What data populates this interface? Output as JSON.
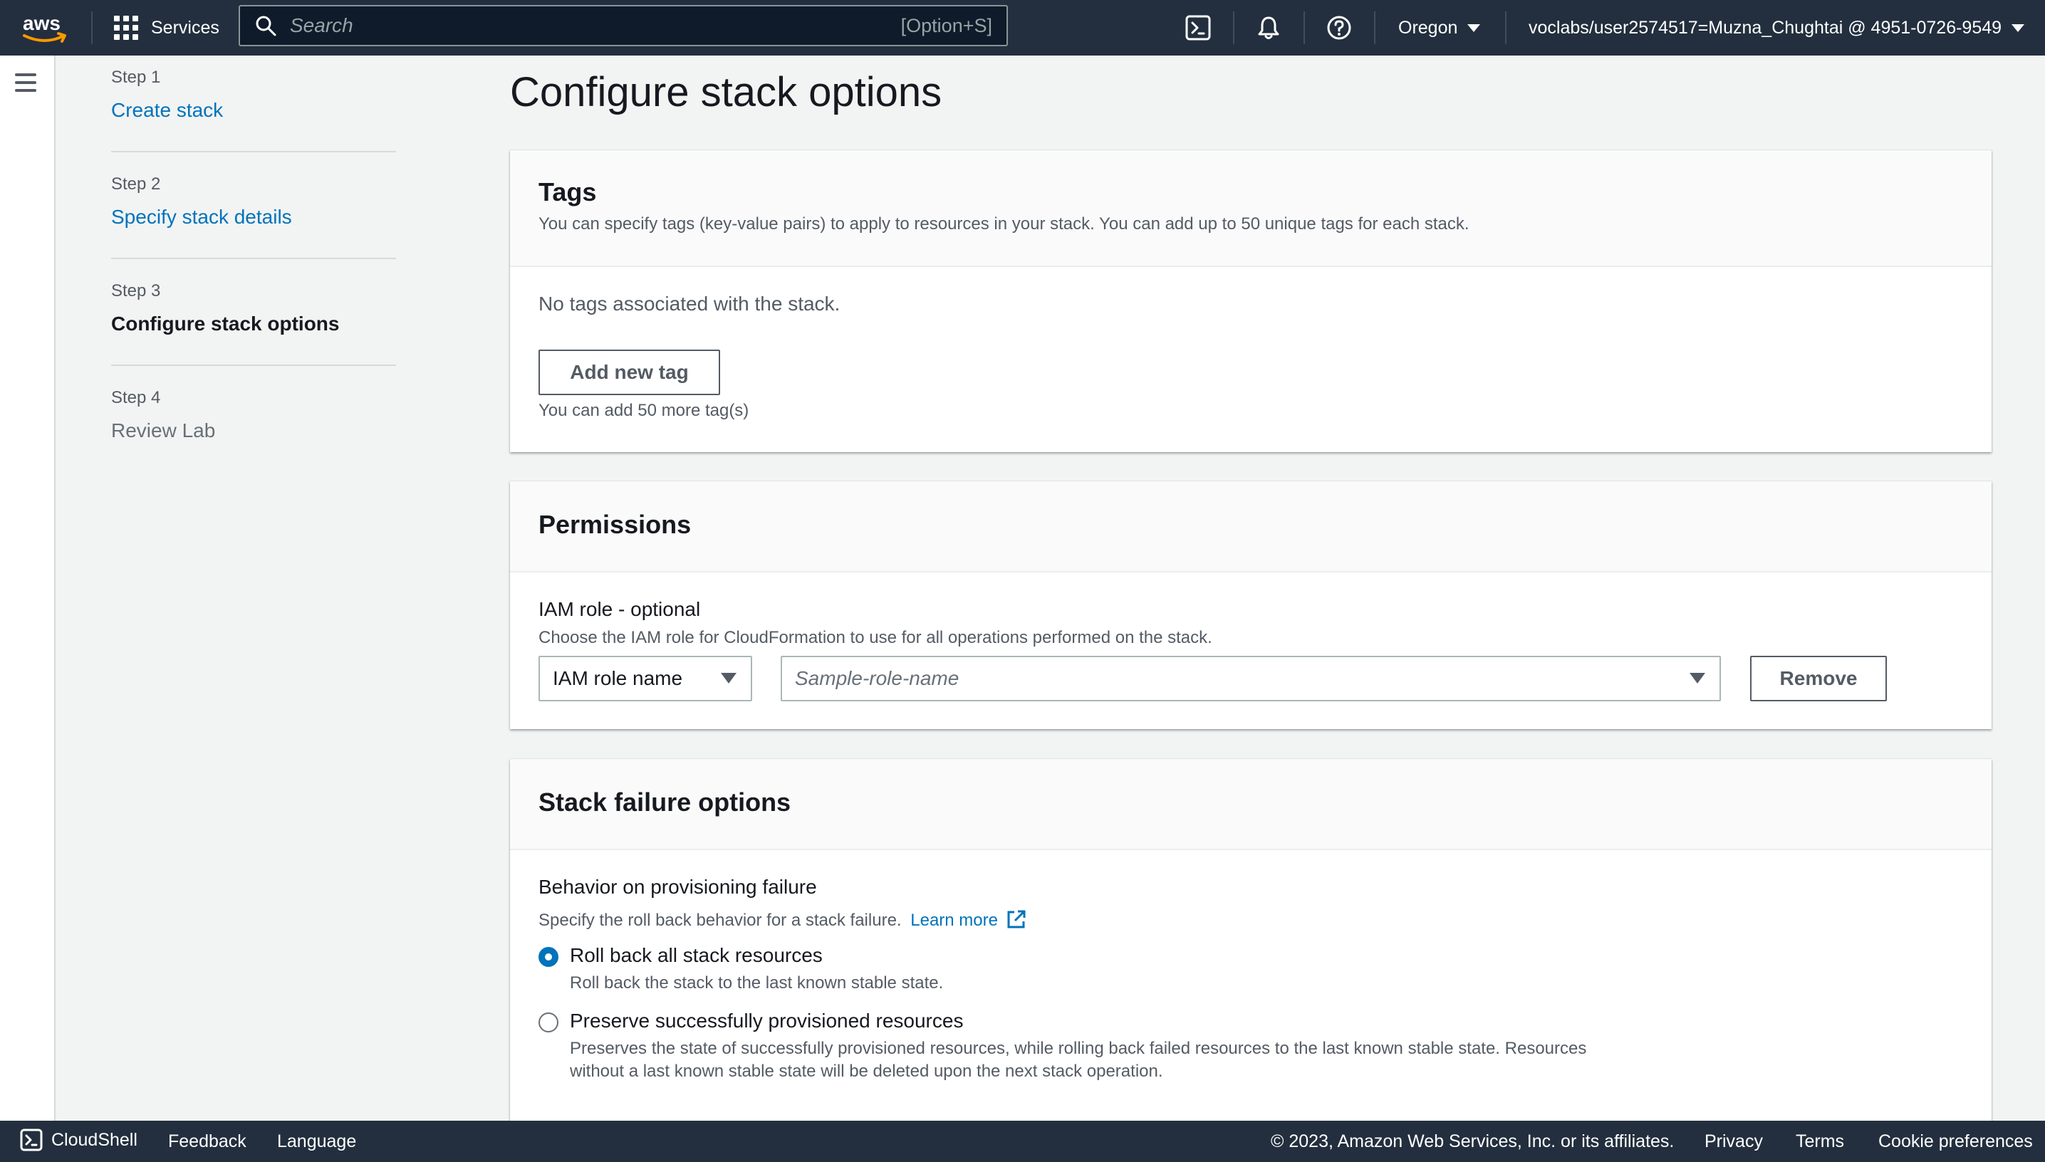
{
  "topnav": {
    "logo_text": "aws",
    "services_label": "Services",
    "search_placeholder": "Search",
    "search_shortcut": "[Option+S]",
    "region": "Oregon",
    "account": "voclabs/user2574517=Muzna_Chughtai @ 4951-0726-9549"
  },
  "steps": [
    {
      "num": "Step 1",
      "label": "Create stack",
      "state": "link"
    },
    {
      "num": "Step 2",
      "label": "Specify stack details",
      "state": "link"
    },
    {
      "num": "Step 3",
      "label": "Configure stack options",
      "state": "current"
    },
    {
      "num": "Step 4",
      "label": "Review Lab",
      "state": "disabled"
    }
  ],
  "page_title": "Configure stack options",
  "tags": {
    "title": "Tags",
    "description": "You can specify tags (key-value pairs) to apply to resources in your stack. You can add up to 50 unique tags for each stack.",
    "empty_text": "No tags associated with the stack.",
    "add_button": "Add new tag",
    "remaining": "You can add 50 more tag(s)"
  },
  "permissions": {
    "title": "Permissions",
    "iam_label": "IAM role - optional",
    "iam_desc": "Choose the IAM role for CloudFormation to use for all operations performed on the stack.",
    "type_select": "IAM role name",
    "role_placeholder": "Sample-role-name",
    "remove_button": "Remove"
  },
  "failure": {
    "title": "Stack failure options",
    "behavior_label": "Behavior on provisioning failure",
    "behavior_desc": "Specify the roll back behavior for a stack failure.",
    "learn_more": "Learn more",
    "options": [
      {
        "label": "Roll back all stack resources",
        "desc_line1": "Roll back the stack to the last known stable state.",
        "desc_line2": "",
        "selected": true
      },
      {
        "label": "Preserve successfully provisioned resources",
        "desc_line1": "Preserves the state of successfully provisioned resources, while rolling back failed resources to the last known stable state. Resources",
        "desc_line2": "without a last known stable state will be deleted upon the next stack operation.",
        "selected": false
      }
    ]
  },
  "footer": {
    "cloudshell": "CloudShell",
    "feedback": "Feedback",
    "language": "Language",
    "copyright": "© 2023, Amazon Web Services, Inc. or its affiliates.",
    "privacy": "Privacy",
    "terms": "Terms",
    "cookies": "Cookie preferences"
  },
  "colors": {
    "nav_bg": "#232f3e",
    "link": "#0073bb",
    "accent_orange": "#ff9900"
  }
}
